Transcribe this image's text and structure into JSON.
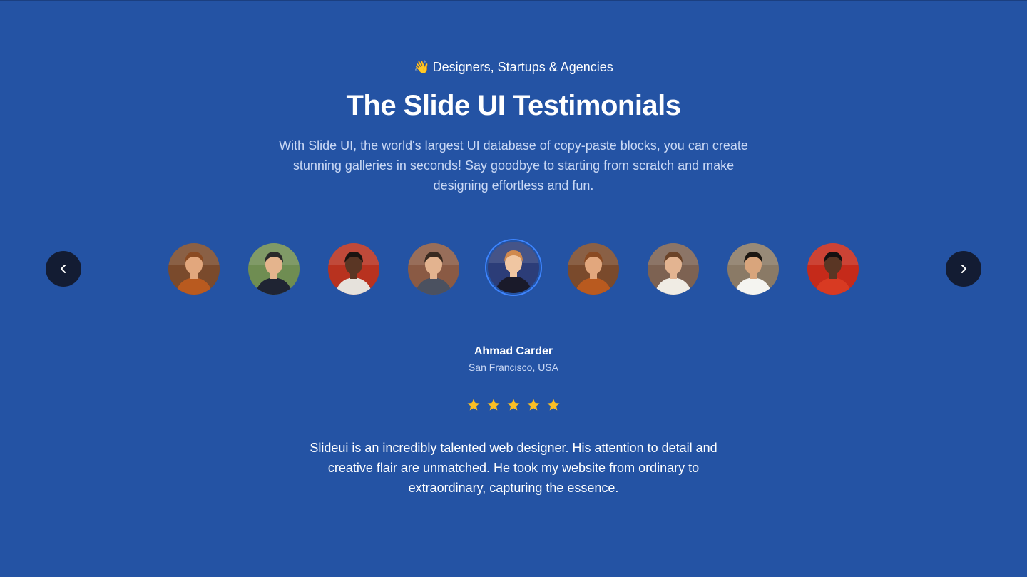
{
  "header": {
    "tagline_emoji": "👋",
    "tagline": "Designers, Startups & Agencies",
    "title": "The Slide UI Testimonials",
    "intro": "With Slide UI, the world's largest UI database of copy-paste blocks, you can create stunning galleries in seconds! Say goodbye to starting from scratch and make designing effortless and fun."
  },
  "carousel": {
    "prev_icon": "chevron-left-icon",
    "next_icon": "chevron-right-icon",
    "active_index": 4,
    "avatars": [
      {
        "icon": "avatar-photo",
        "bg": "#7a4a2c",
        "skin": "#e2a77d",
        "hair": "#8a4a22",
        "shirt": "#b95a1f"
      },
      {
        "icon": "avatar-photo",
        "bg": "#6f8d52",
        "skin": "#e4b48d",
        "hair": "#2a2a2a",
        "shirt": "#1f2433"
      },
      {
        "icon": "avatar-photo",
        "bg": "#b8321f",
        "skin": "#5a3624",
        "hair": "#1b1410",
        "shirt": "#e6e2dc"
      },
      {
        "icon": "avatar-photo",
        "bg": "#8a5a44",
        "skin": "#e3b38f",
        "hair": "#3a2a20",
        "shirt": "#4b5160"
      },
      {
        "icon": "avatar-photo",
        "bg": "#2c3d78",
        "skin": "#f0c6a2",
        "hair": "#d0894e",
        "shirt": "#1a1a2a"
      },
      {
        "icon": "avatar-photo",
        "bg": "#7a4a2c",
        "skin": "#e2a77d",
        "hair": "#8a4a22",
        "shirt": "#b95a1f"
      },
      {
        "icon": "avatar-photo",
        "bg": "#7d6252",
        "skin": "#e3b491",
        "hair": "#6b4328",
        "shirt": "#f0ece4"
      },
      {
        "icon": "avatar-photo",
        "bg": "#8a7a66",
        "skin": "#d9a57c",
        "hair": "#1c1712",
        "shirt": "#f4f4f0"
      },
      {
        "icon": "avatar-photo",
        "bg": "#c52a1a",
        "skin": "#5a3624",
        "hair": "#151010",
        "shirt": "#d83a22"
      }
    ]
  },
  "testimonial": {
    "name": "Ahmad Carder",
    "location": "San Francisco, USA",
    "rating": 5,
    "rating_max": 5,
    "star_color": "#fbbf24",
    "quote": "Slideui is an incredibly talented web designer. His attention to detail and creative flair are unmatched. He took my website from ordinary to extraordinary, capturing the essence."
  },
  "colors": {
    "background": "#2453a4",
    "nav_button": "#131c33",
    "active_ring": "#3e85ff"
  }
}
